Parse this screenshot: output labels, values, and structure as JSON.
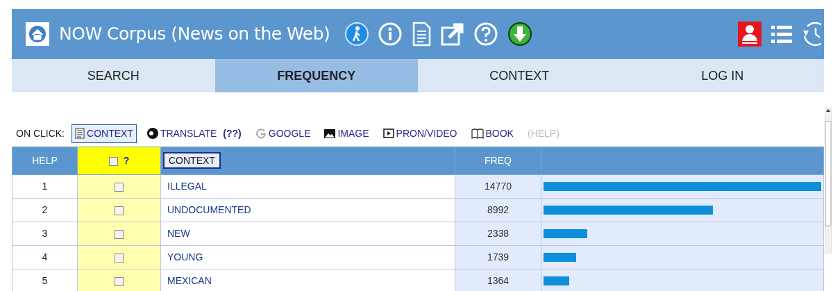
{
  "header": {
    "title": "NOW Corpus (News on the Web)"
  },
  "tabs": [
    {
      "label": "SEARCH",
      "selected": false
    },
    {
      "label": "FREQUENCY",
      "selected": true
    },
    {
      "label": "CONTEXT",
      "selected": false
    },
    {
      "label": "LOG IN",
      "selected": false
    }
  ],
  "on_click": {
    "label": "ON CLICK:",
    "options": [
      {
        "kind": "context",
        "label": "CONTEXT",
        "selected": true,
        "disabled": false
      },
      {
        "kind": "translate",
        "label": "TRANSLATE",
        "extra": "(??)",
        "selected": false,
        "disabled": false
      },
      {
        "kind": "google",
        "label": "GOOGLE",
        "selected": false,
        "disabled": false
      },
      {
        "kind": "image",
        "label": "IMAGE",
        "selected": false,
        "disabled": false
      },
      {
        "kind": "video",
        "label": "PRON/VIDEO",
        "selected": false,
        "disabled": false
      },
      {
        "kind": "book",
        "label": "BOOK",
        "selected": false,
        "disabled": false
      },
      {
        "kind": "help",
        "label": "(HELP)",
        "selected": false,
        "disabled": true
      }
    ]
  },
  "table": {
    "columns": {
      "help": "HELP",
      "check_hint": "?",
      "check_all": false,
      "context": "CONTEXT",
      "freq": "FREQ"
    },
    "rows": [
      {
        "number": "1",
        "checked": false,
        "word": "ILLEGAL",
        "freq": "14770",
        "level": 1.0
      },
      {
        "number": "2",
        "checked": false,
        "word": "UNDOCUMENTED",
        "freq": "8992",
        "level": 0.61
      },
      {
        "number": "3",
        "checked": false,
        "word": "NEW",
        "freq": "2338",
        "level": 0.158
      },
      {
        "number": "4",
        "checked": false,
        "word": "YOUNG",
        "freq": "1739",
        "level": 0.118
      },
      {
        "number": "5",
        "checked": false,
        "word": "MEXICAN",
        "freq": "1364",
        "level": 0.092
      }
    ]
  }
}
